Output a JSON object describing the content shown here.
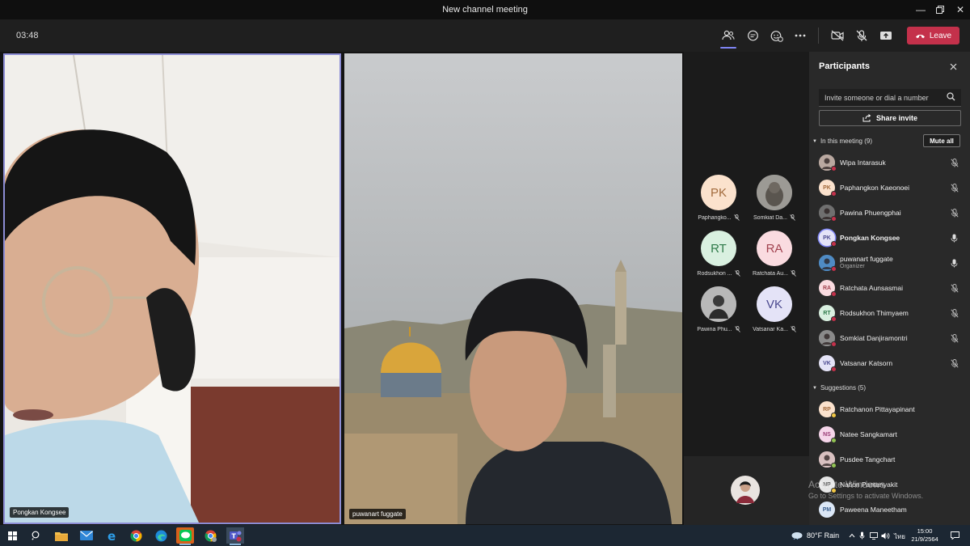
{
  "window": {
    "title": "New channel meeting"
  },
  "toolbar": {
    "timer": "03:48",
    "leave_label": "Leave"
  },
  "stage": {
    "main_tiles": [
      {
        "name": "Pongkan Kongsee"
      },
      {
        "name": "puwanart fuggate"
      }
    ],
    "grid": [
      {
        "initials": "PK",
        "name": "Paphangko...",
        "bg": "#fbe2cd",
        "fg": "#a26b3d"
      },
      {
        "initials": "",
        "name": "Somkiat Da...",
        "bg": "#8a8a8a",
        "fg": "#fff"
      },
      {
        "initials": "RT",
        "name": "Rodsukhon ...",
        "bg": "#d9f0e0",
        "fg": "#2f7a4a"
      },
      {
        "initials": "RA",
        "name": "Ratchata Au...",
        "bg": "#fadbe0",
        "fg": "#a1424f"
      },
      {
        "initials": "",
        "name": "Pawina Phu...",
        "bg": "#6f6f6f",
        "fg": "#fff"
      },
      {
        "initials": "VK",
        "name": "Vatsanar Ka...",
        "bg": "#e4e3f7",
        "fg": "#4b4a8f"
      }
    ]
  },
  "panel": {
    "title": "Participants",
    "invite_placeholder": "Invite someone or dial a number",
    "share_label": "Share invite",
    "in_meeting_label": "In this meeting (9)",
    "mute_all_label": "Mute all",
    "suggestions_label": "Suggestions (5)",
    "in_meeting": [
      {
        "name": "Wipa Intarasuk",
        "initials": "",
        "bg": "#b9a8a0",
        "fg": "#fff",
        "status": "#c4314b",
        "mic": "muted"
      },
      {
        "name": "Paphangkon Kaeonoei",
        "initials": "PK",
        "bg": "#fbe2cd",
        "fg": "#a26b3d",
        "status": "#c4314b",
        "mic": "muted"
      },
      {
        "name": "Pawina Phuengphai",
        "initials": "",
        "bg": "#6f6f6f",
        "fg": "#fff",
        "status": "#c4314b",
        "mic": "muted"
      },
      {
        "name": "Pongkan Kongsee",
        "initials": "PK",
        "bg": "#e4e3f7",
        "fg": "#4b4a8f",
        "status": "#c4314b",
        "mic": "on",
        "bold": true
      },
      {
        "name": "puwanart fuggate",
        "role": "Organizer",
        "initials": "",
        "bg": "#4f8bc4",
        "fg": "#fff",
        "status": "#c4314b",
        "mic": "on"
      },
      {
        "name": "Ratchata Aunsasmai",
        "initials": "RA",
        "bg": "#fadbe0",
        "fg": "#a1424f",
        "status": "#c4314b",
        "mic": "muted"
      },
      {
        "name": "Rodsukhon Thimyaem",
        "initials": "RT",
        "bg": "#d9f0e0",
        "fg": "#2f7a4a",
        "status": "#c4314b",
        "mic": "muted"
      },
      {
        "name": "Somkiat Danjiramontri",
        "initials": "",
        "bg": "#8a8a8a",
        "fg": "#fff",
        "status": "#c4314b",
        "mic": "muted"
      },
      {
        "name": "Vatsanar Katsorn",
        "initials": "VK",
        "bg": "#e4e3f7",
        "fg": "#4b4a8f",
        "status": "#c4314b",
        "mic": "muted"
      }
    ],
    "suggestions": [
      {
        "name": "Ratchanon Pittayapinant",
        "initials": "RP",
        "bg": "#fbe2cd",
        "fg": "#a26b3d",
        "status": "#f2c744"
      },
      {
        "name": "Natee Sangkamart",
        "initials": "NS",
        "bg": "#f6d6ea",
        "fg": "#9a3c76",
        "status": "#92c353"
      },
      {
        "name": "Pusdee Tangchart",
        "initials": "",
        "bg": "#d8c0c0",
        "fg": "#fff",
        "status": "#92c353"
      },
      {
        "name": "Nation Pantanyakit",
        "initials": "NP",
        "bg": "#e6e6e6",
        "fg": "#555",
        "status": "#f2c744"
      },
      {
        "name": "Paweena Maneetham",
        "initials": "PM",
        "bg": "#dbe7f6",
        "fg": "#3a5f8f",
        "status": ""
      }
    ]
  },
  "watermark": {
    "line1": "Activate Windows",
    "line2": "Go to Settings to activate Windows."
  },
  "taskbar": {
    "weather": "80°F  Rain",
    "language": "ไทย",
    "time": "15:00",
    "date": "21/9/2564"
  },
  "colors": {
    "accent": "#7f85f5",
    "leave": "#c4314b",
    "panel": "#292929",
    "stage": "#141414"
  }
}
